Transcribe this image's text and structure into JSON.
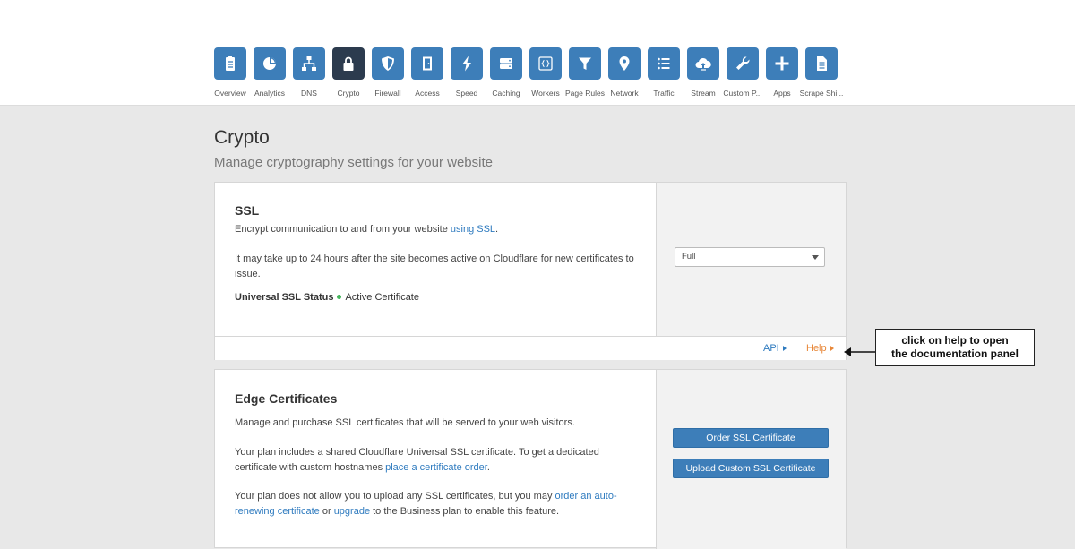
{
  "nav": {
    "items": [
      {
        "label": "Overview",
        "icon": "clipboard-icon"
      },
      {
        "label": "Analytics",
        "icon": "pie-chart-icon"
      },
      {
        "label": "DNS",
        "icon": "sitemap-icon"
      },
      {
        "label": "Crypto",
        "icon": "lock-icon",
        "active": true
      },
      {
        "label": "Firewall",
        "icon": "shield-icon"
      },
      {
        "label": "Access",
        "icon": "door-icon"
      },
      {
        "label": "Speed",
        "icon": "lightning-icon"
      },
      {
        "label": "Caching",
        "icon": "server-icon"
      },
      {
        "label": "Workers",
        "icon": "code-braces-icon"
      },
      {
        "label": "Page Rules",
        "icon": "filter-icon"
      },
      {
        "label": "Network",
        "icon": "map-pin-icon"
      },
      {
        "label": "Traffic",
        "icon": "list-icon"
      },
      {
        "label": "Stream",
        "icon": "cloud-upload-icon"
      },
      {
        "label": "Custom P...",
        "icon": "wrench-icon"
      },
      {
        "label": "Apps",
        "icon": "plus-icon"
      },
      {
        "label": "Scrape Shi...",
        "icon": "document-icon"
      }
    ]
  },
  "page": {
    "title": "Crypto",
    "subtitle": "Manage cryptography settings for your website"
  },
  "ssl": {
    "title": "SSL",
    "desc_prefix": "Encrypt communication to and from your website ",
    "desc_link": "using SSL",
    "desc_suffix": ".",
    "note": "It may take up to 24 hours after the site becomes active on Cloudflare for new certificates to issue.",
    "status_label": "Universal SSL Status",
    "status_value": "Active Certificate",
    "select_value": "Full",
    "api_link": "API",
    "help_link": "Help"
  },
  "edge": {
    "title": "Edge Certificates",
    "desc": "Manage and purchase SSL certificates that will be served to your web visitors.",
    "p2_prefix": "Your plan includes a shared Cloudflare Universal SSL certificate. To get a dedicated certificate with custom hostnames ",
    "p2_link": "place a certificate order",
    "p2_suffix": ".",
    "p3_prefix": "Your plan does not allow you to upload any SSL certificates, but you may ",
    "p3_link1": "order an auto-renewing certificate",
    "p3_mid": " or ",
    "p3_link2": "upgrade",
    "p3_suffix": " to the Business plan to enable this feature.",
    "order_button": "Order SSL Certificate",
    "upload_button": "Upload Custom SSL Certificate"
  },
  "callout": {
    "line1": "click on help to open",
    "line2": "the documentation panel"
  },
  "colors": {
    "accent": "#3d7eb9",
    "active_nav": "#2c3b4e",
    "help": "#e8883a",
    "status_ok": "#43b55b"
  }
}
